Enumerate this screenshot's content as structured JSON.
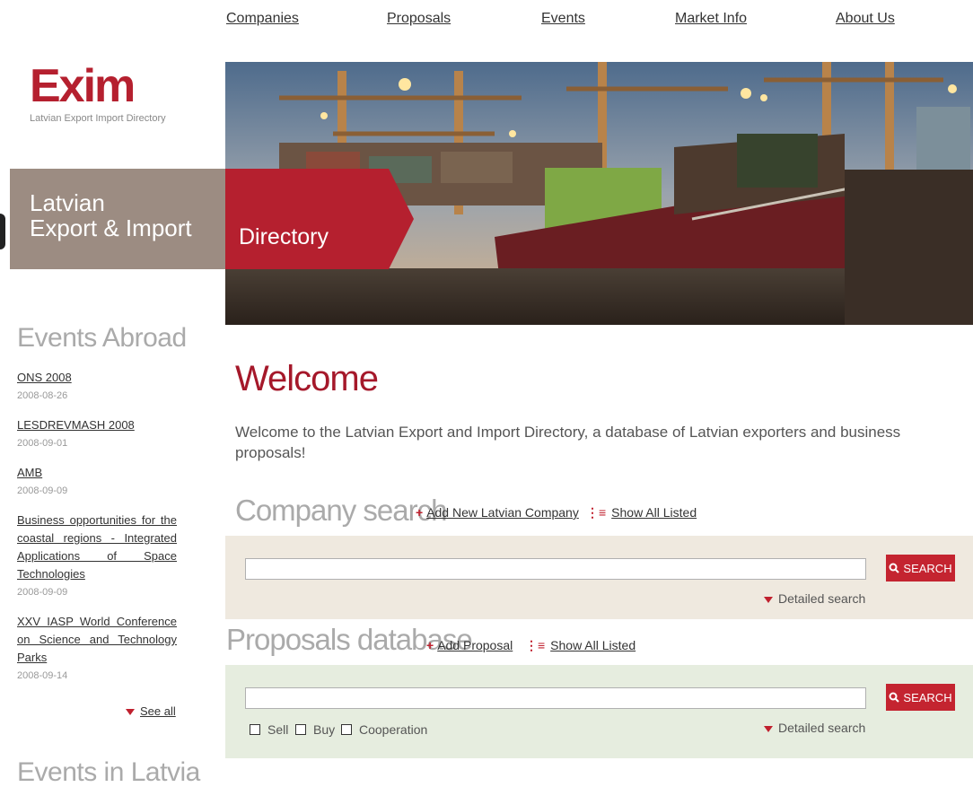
{
  "nav": {
    "items": [
      {
        "label": "Companies"
      },
      {
        "label": "Proposals"
      },
      {
        "label": "Events"
      },
      {
        "label": "Market Info"
      },
      {
        "label": "About Us"
      }
    ]
  },
  "logo": {
    "mark": "Exim",
    "subtitle": "Latvian Export Import Directory"
  },
  "banner": {
    "line1": "Latvian",
    "line2": "Export & Import",
    "tag": "Directory"
  },
  "events_abroad": {
    "heading": "Events Abroad",
    "items": [
      {
        "title": "ONS 2008",
        "date": "2008-08-26"
      },
      {
        "title": "LESDREVMASH 2008",
        "date": "2008-09-01"
      },
      {
        "title": "AMB",
        "date": "2008-09-09"
      },
      {
        "title": "Business opportunities for the coastal regions - Integrated Applications of Space Technologies",
        "date": "2008-09-09"
      },
      {
        "title": "XXV IASP World Conference on Science and Technology Parks",
        "date": "2008-09-14"
      }
    ],
    "see_all": "See all"
  },
  "events_latvia": {
    "heading": "Events in Latvia"
  },
  "welcome": {
    "heading": "Welcome",
    "text": "Welcome to the Latvian Export and Import Directory, a database of Latvian exporters and business proposals!"
  },
  "company_search": {
    "heading": "Company search",
    "add_link": "Add New Latvian Company",
    "show_link": "Show All Listed",
    "search_value": "",
    "button": "SEARCH",
    "detailed": "Detailed search"
  },
  "proposals": {
    "heading": "Proposals database",
    "add_link": "Add Proposal",
    "show_link": "Show All Listed",
    "search_value": "",
    "button": "SEARCH",
    "detailed": "Detailed search",
    "checkboxes": [
      {
        "label": "Sell",
        "checked": false
      },
      {
        "label": "Buy",
        "checked": false
      },
      {
        "label": "Cooperation",
        "checked": false
      }
    ]
  },
  "colors": {
    "brand_red": "#b5202f",
    "banner_grey": "#9c8c82",
    "company_panel": "#efe9df",
    "proposal_panel": "#e6eddf"
  }
}
